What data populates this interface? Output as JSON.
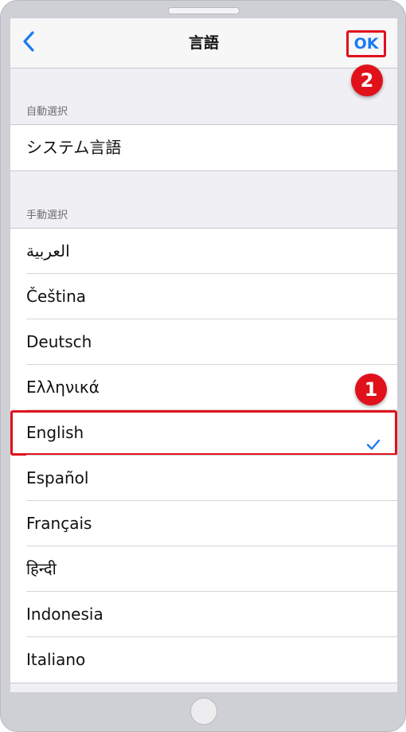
{
  "navbar": {
    "title": "言語",
    "ok_label": "OK"
  },
  "sections": {
    "auto_header": "自動選択",
    "manual_header": "手動選択"
  },
  "auto_items": [
    "システム言語"
  ],
  "languages": [
    "العربية",
    "Čeština",
    "Deutsch",
    "Ελληνικά",
    "English",
    "Español",
    "Français",
    "हिन्दी",
    "Indonesia",
    "Italiano"
  ],
  "selected_language": "English",
  "annotations": {
    "marker_1": "1",
    "marker_2": "2"
  },
  "colors": {
    "accent": "#1b7cf0",
    "highlight": "#e0111b",
    "background": "#efeff4"
  },
  "icons": {
    "back": "chevron-left-icon",
    "selected": "checkmark-icon"
  }
}
